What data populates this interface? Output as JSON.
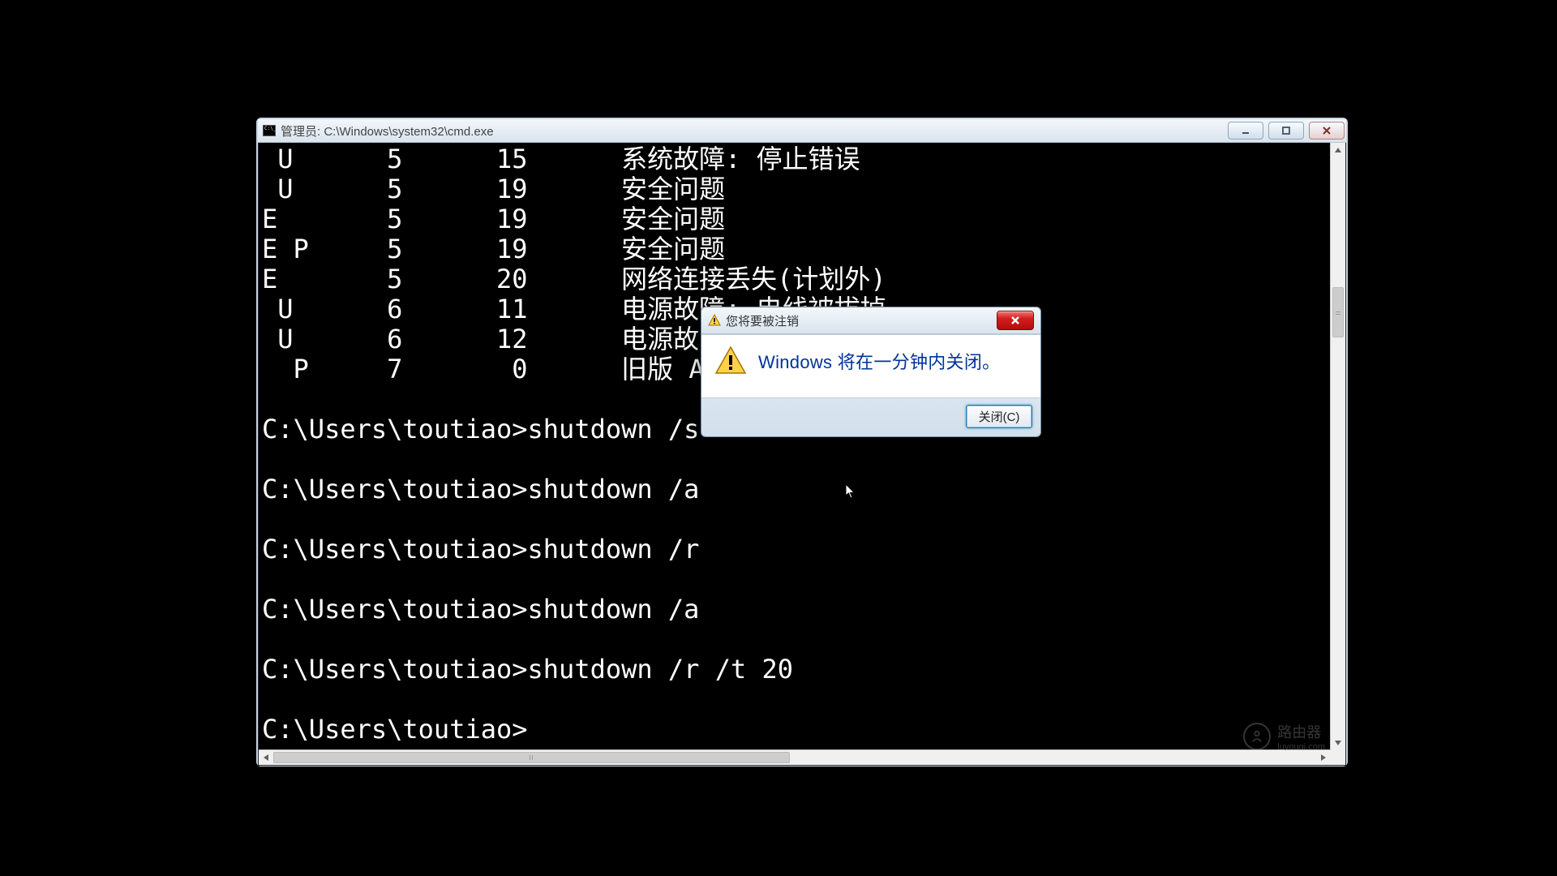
{
  "window": {
    "title": "管理员: C:\\Windows\\system32\\cmd.exe"
  },
  "terminal": {
    "rows": [
      " U      5      15      系统故障: 停止错误",
      " U      5      19      安全问题",
      "E       5      19      安全问题",
      "E P     5      19      安全问题",
      "E       5      20      网络连接丢失(计划外)",
      " U      6      11      电源故障: 电线被拔掉",
      " U      6      12      电源故障: 环境",
      "  P     7       0      旧版 API 关机"
    ],
    "commands": [
      "C:\\Users\\toutiao>shutdown /s",
      "C:\\Users\\toutiao>shutdown /a",
      "C:\\Users\\toutiao>shutdown /r",
      "C:\\Users\\toutiao>shutdown /a",
      "C:\\Users\\toutiao>shutdown /r /t 20",
      "C:\\Users\\toutiao>"
    ]
  },
  "dialog": {
    "title": "您将要被注销",
    "message": "Windows 将在一分钟内关闭。",
    "button": "关闭(C)"
  },
  "watermark": {
    "line1": "路由器",
    "line2": "luyouqi.com"
  }
}
